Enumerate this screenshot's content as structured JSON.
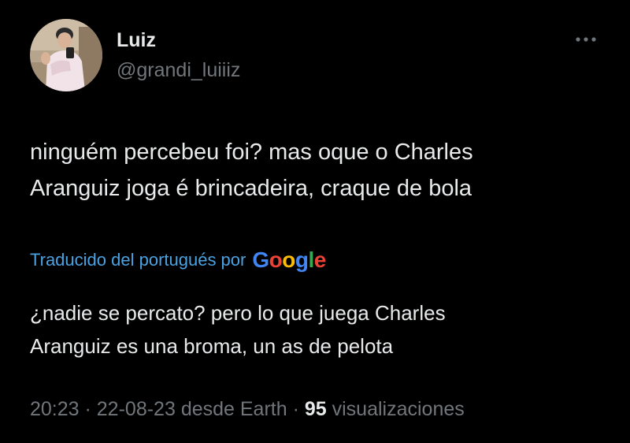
{
  "colors": {
    "background": "#000000",
    "primary_text": "#e7e9ea",
    "secondary_text": "#71767b",
    "link": "#4aa2e3",
    "google_blue": "#4285F4",
    "google_red": "#EA4335",
    "google_yellow": "#FBBC05",
    "google_green": "#34A853"
  },
  "author": {
    "display_name": "Luiz",
    "handle": "@grandi_luiiiz",
    "avatar_icon": "user-avatar-photo"
  },
  "more_icon": "more-horizontal-icon",
  "tweet": {
    "text_line_1": "ninguém percebeu foi? mas oque o Charles",
    "text_line_2": "Aranguiz joga é brincadeira, craque de bola"
  },
  "translation": {
    "label": "Traducido del portugués por",
    "provider_letters": [
      "G",
      "o",
      "o",
      "g",
      "l",
      "e"
    ],
    "text_line_1": "¿nadie se percato? pero lo que juega Charles",
    "text_line_2": "Aranguiz es una broma, un as de pelota"
  },
  "meta": {
    "time": "20:23",
    "date": "22-08-23",
    "source": "desde Earth",
    "separator": " · ",
    "views_count": "95",
    "views_label": "visualizaciones"
  }
}
